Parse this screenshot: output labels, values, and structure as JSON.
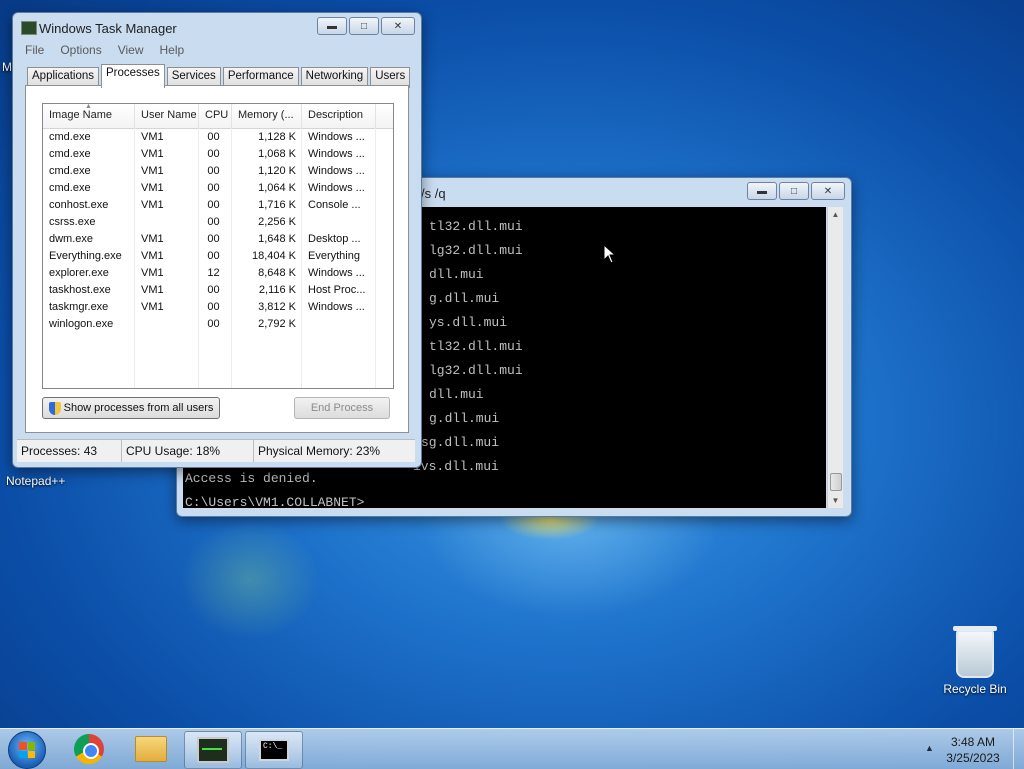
{
  "desktop": {
    "left_label": "M",
    "recycle_bin_label": "Recycle Bin",
    "notepad_label": "Notepad++"
  },
  "taskmgr": {
    "title": "Windows Task Manager",
    "menu": [
      "File",
      "Options",
      "View",
      "Help"
    ],
    "tabs": [
      "Applications",
      "Processes",
      "Services",
      "Performance",
      "Networking",
      "Users"
    ],
    "active_tab": "Processes",
    "columns": [
      "Image Name",
      "User Name",
      "CPU",
      "Memory (...",
      "Description"
    ],
    "rows": [
      {
        "name": "cmd.exe",
        "user": "VM1",
        "cpu": "00",
        "mem": "1,128 K",
        "desc": "Windows ..."
      },
      {
        "name": "cmd.exe",
        "user": "VM1",
        "cpu": "00",
        "mem": "1,068 K",
        "desc": "Windows ..."
      },
      {
        "name": "cmd.exe",
        "user": "VM1",
        "cpu": "00",
        "mem": "1,120 K",
        "desc": "Windows ..."
      },
      {
        "name": "cmd.exe",
        "user": "VM1",
        "cpu": "00",
        "mem": "1,064 K",
        "desc": "Windows ..."
      },
      {
        "name": "conhost.exe",
        "user": "VM1",
        "cpu": "00",
        "mem": "1,716 K",
        "desc": "Console ..."
      },
      {
        "name": "csrss.exe",
        "user": "",
        "cpu": "00",
        "mem": "2,256 K",
        "desc": ""
      },
      {
        "name": "dwm.exe",
        "user": "VM1",
        "cpu": "00",
        "mem": "1,648 K",
        "desc": "Desktop ..."
      },
      {
        "name": "Everything.exe",
        "user": "VM1",
        "cpu": "00",
        "mem": "18,404 K",
        "desc": "Everything"
      },
      {
        "name": "explorer.exe",
        "user": "VM1",
        "cpu": "12",
        "mem": "8,648 K",
        "desc": "Windows ..."
      },
      {
        "name": "taskhost.exe",
        "user": "VM1",
        "cpu": "00",
        "mem": "2,116 K",
        "desc": "Host Proc..."
      },
      {
        "name": "taskmgr.exe",
        "user": "VM1",
        "cpu": "00",
        "mem": "3,812 K",
        "desc": "Windows ..."
      },
      {
        "name": "winlogon.exe",
        "user": "",
        "cpu": "00",
        "mem": "2,792 K",
        "desc": ""
      }
    ],
    "show_all_button": "Show processes from all users",
    "end_process_button": "End Process",
    "status": {
      "processes": "Processes: 43",
      "cpu": "CPU Usage: 18%",
      "memory": "Physical Memory: 23%"
    }
  },
  "console": {
    "title_fragment": "/s /q",
    "lines": [
      "tl32.dll.mui",
      "lg32.dll.mui",
      "dll.mui",
      "g.dll.mui",
      "ys.dll.mui",
      "tl32.dll.mui",
      "lg32.dll.mui",
      "dll.mui",
      "g.dll.mui",
      "sg.dll.mui",
      "ivs.dll.mui"
    ],
    "access_denied": "Access is denied.",
    "prompt": "C:\\Users\\VM1.COLLABNET>"
  },
  "taskbar": {
    "cmd_icon_text": "C:\\_",
    "time": "3:48 AM",
    "date": "3/25/2023"
  }
}
